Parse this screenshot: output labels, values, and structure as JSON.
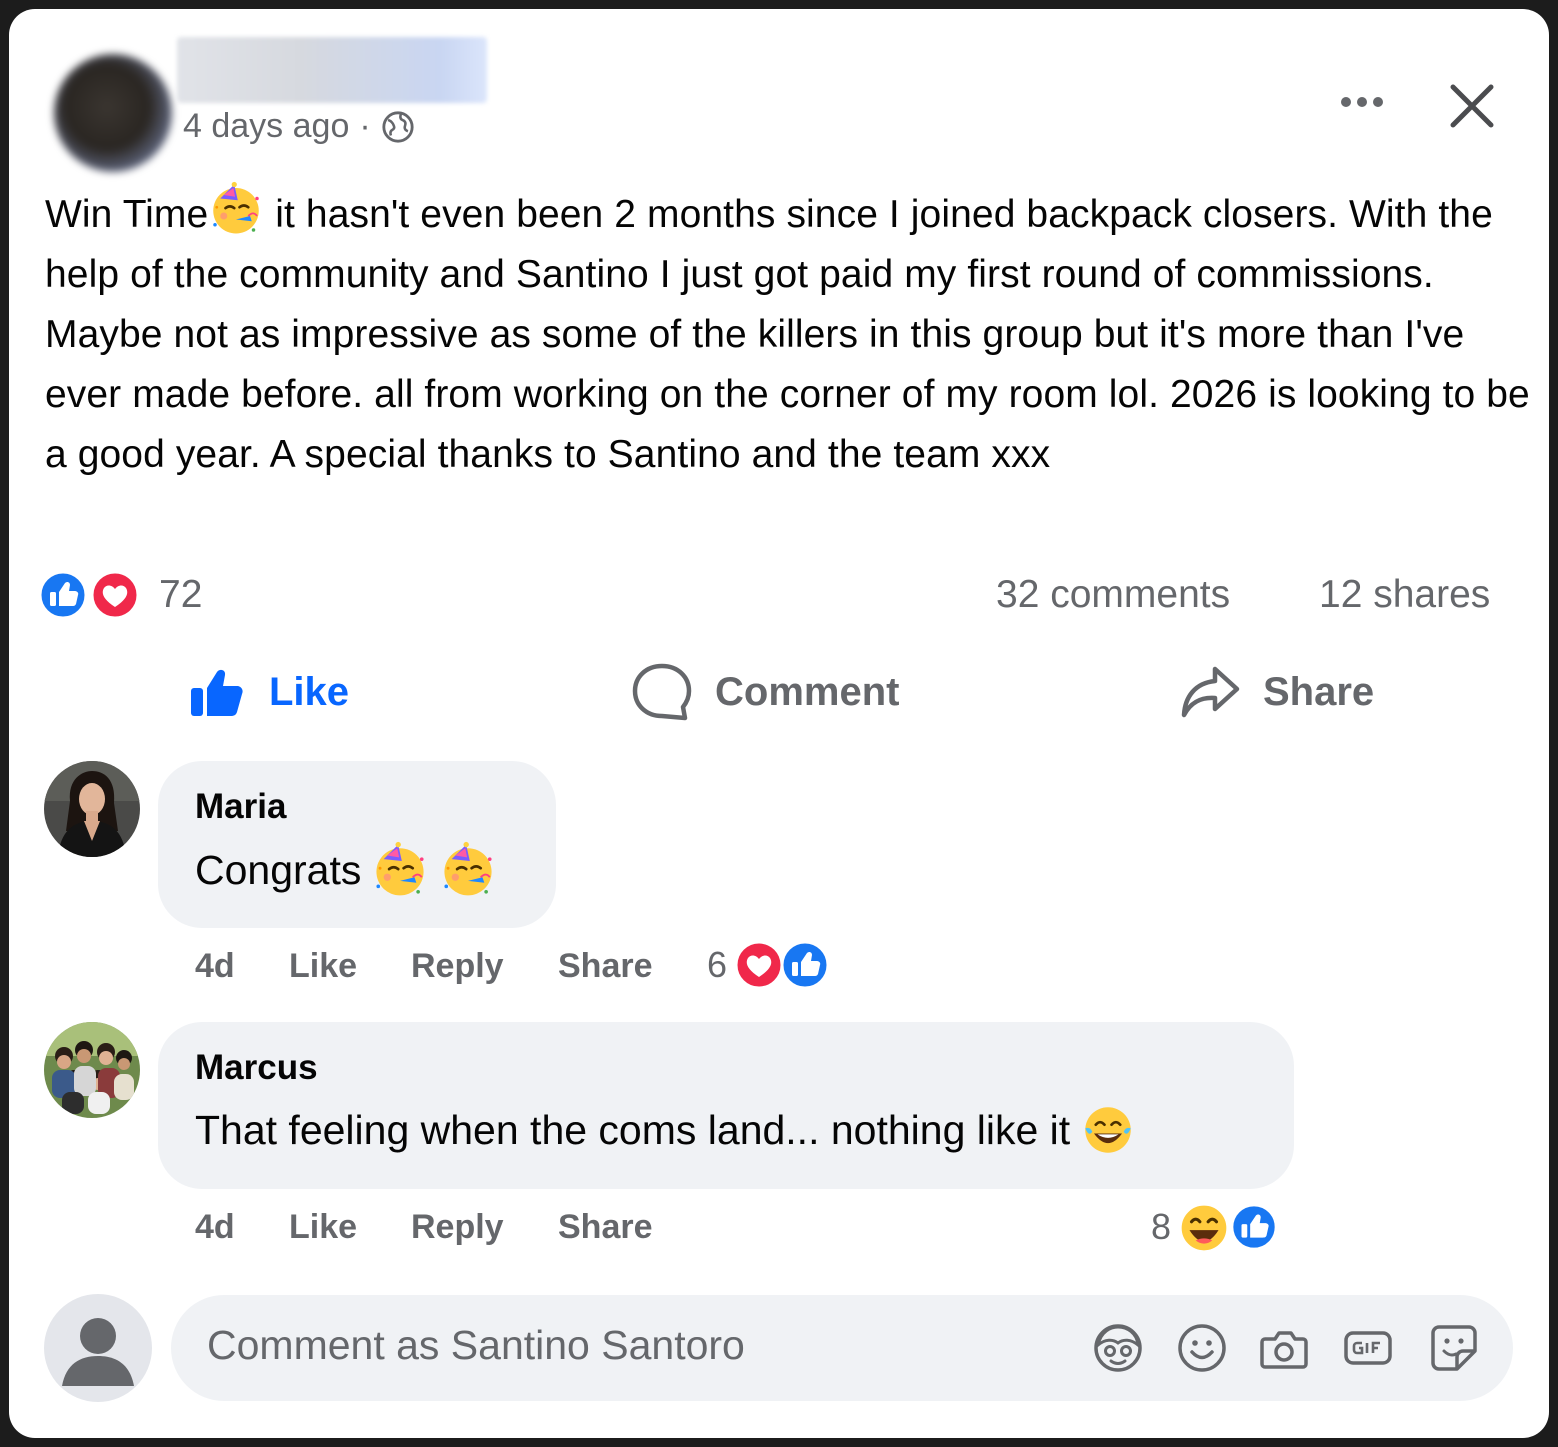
{
  "post": {
    "timestamp": "4 days ago",
    "separator": "·",
    "privacy_icon": "globe-icon",
    "text_lead": "Win Time",
    "text_body": " it hasn't even been 2 months since I joined backpack closers. With the help of the community and Santino I just got paid my first round of commissions. Maybe not as impressive as some of the killers in this group but it's more than I've ever made before. all from working on the corner of my room lol. 2026 is looking to be a good year. A special thanks to Santino and the team xxx",
    "emoji": "partying-face"
  },
  "stats": {
    "reactions_count": "72",
    "reaction_types": [
      "like",
      "love"
    ],
    "comments": "32 comments",
    "shares": "12 shares"
  },
  "actions": {
    "like": "Like",
    "comment": "Comment",
    "share": "Share"
  },
  "comments": [
    {
      "author": "Maria",
      "text": "Congrats",
      "emojis": [
        "partying-face",
        "partying-face"
      ],
      "time": "4d",
      "like": "Like",
      "reply": "Reply",
      "share": "Share",
      "reaction_count": "6",
      "reaction_types": [
        "love",
        "like"
      ]
    },
    {
      "author": "Marcus",
      "text": "That feeling when the coms land... nothing like it",
      "emojis": [
        "tears-of-joy"
      ],
      "time": "4d",
      "like": "Like",
      "reply": "Reply",
      "share": "Share",
      "reaction_count": "8",
      "reaction_types": [
        "haha",
        "like"
      ]
    }
  ],
  "composer": {
    "placeholder": "Comment as Santino Santoro",
    "icons": [
      "avatar-sticker-icon",
      "emoji-icon",
      "camera-icon",
      "gif-icon",
      "sticker-icon"
    ]
  },
  "colors": {
    "brand_blue": "#0866ff",
    "love_red": "#f0284a",
    "text_primary": "#050505",
    "text_secondary": "#65676b",
    "bubble_bg": "#f0f2f5"
  }
}
